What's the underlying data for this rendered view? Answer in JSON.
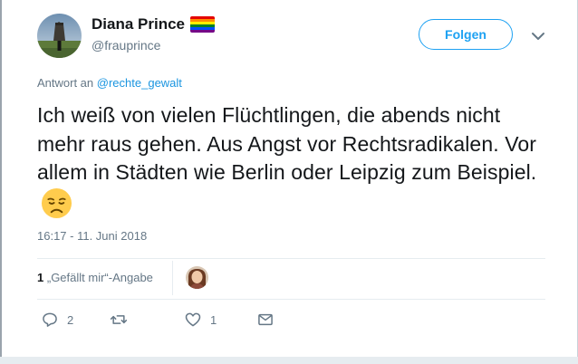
{
  "user": {
    "display_name": "Diana Prince",
    "handle": "@frauprince",
    "badge_icon": "rainbow-flag-icon"
  },
  "header": {
    "follow_label": "Folgen",
    "menu_icon": "chevron-down-icon"
  },
  "tweet": {
    "reply_prefix": "Antwort an",
    "reply_to": "@rechte_gewalt",
    "text": "Ich weiß von vielen Flüchtlingen, die abends nicht mehr raus gehen. Aus Angst vor Rechtsradikalen. Vor allem in Städten wie Berlin oder Leipzig zum Beispiel.",
    "emoji": "disappointed-face-emoji",
    "timestamp": "16:17 - 11. Juni 2018"
  },
  "engagement": {
    "likes_count": "1",
    "likes_label": "„Gefällt mir“-Angabe"
  },
  "actions": {
    "reply_count": "2",
    "retweet_count": "",
    "like_count": "1"
  },
  "colors": {
    "accent": "#1da1f2",
    "link": "#1b95e0",
    "muted": "#657786",
    "text": "#14171a",
    "divider": "#e6ecf0"
  }
}
